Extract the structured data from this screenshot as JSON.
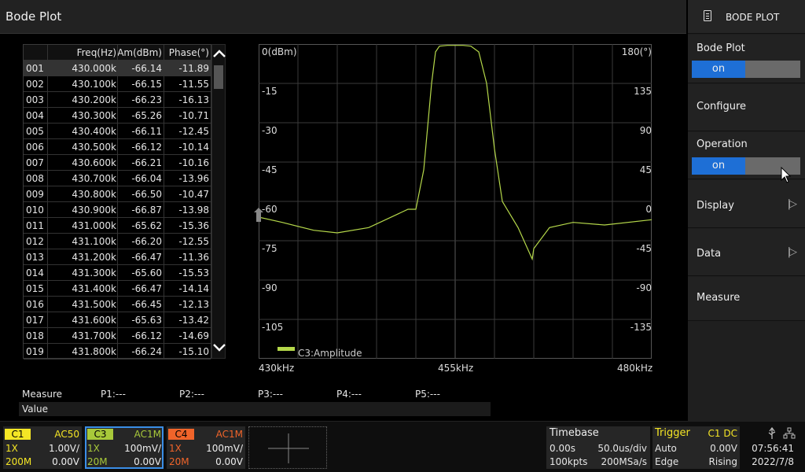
{
  "title": "Bode Plot",
  "menu": {
    "header": "BODE PLOT",
    "items": [
      {
        "label": "Bode Plot",
        "toggle": "on"
      },
      {
        "label": "Configure"
      },
      {
        "label": "Operation",
        "toggle": "on"
      },
      {
        "label": "Display",
        "arrow": "|▷"
      },
      {
        "label": "Data",
        "arrow": "|▷"
      },
      {
        "label": "Measure"
      }
    ]
  },
  "table": {
    "headers": [
      "Freq(Hz)",
      "Am(dBm)",
      "Phase(°)"
    ],
    "rows": [
      [
        "001",
        "430.000k",
        "-66.14",
        "-11.89"
      ],
      [
        "002",
        "430.100k",
        "-66.15",
        "-11.55"
      ],
      [
        "003",
        "430.200k",
        "-66.23",
        "-16.13"
      ],
      [
        "004",
        "430.300k",
        "-65.26",
        "-10.71"
      ],
      [
        "005",
        "430.400k",
        "-66.11",
        "-12.45"
      ],
      [
        "006",
        "430.500k",
        "-66.12",
        "-10.14"
      ],
      [
        "007",
        "430.600k",
        "-66.21",
        "-10.16"
      ],
      [
        "008",
        "430.700k",
        "-66.04",
        "-13.96"
      ],
      [
        "009",
        "430.800k",
        "-66.50",
        "-10.47"
      ],
      [
        "010",
        "430.900k",
        "-66.87",
        "-13.98"
      ],
      [
        "011",
        "431.000k",
        "-65.62",
        "-15.36"
      ],
      [
        "012",
        "431.100k",
        "-66.20",
        "-12.55"
      ],
      [
        "013",
        "431.200k",
        "-66.47",
        "-11.36"
      ],
      [
        "014",
        "431.300k",
        "-65.60",
        "-15.53"
      ],
      [
        "015",
        "431.400k",
        "-66.47",
        "-14.14"
      ],
      [
        "016",
        "431.500k",
        "-66.45",
        "-12.13"
      ],
      [
        "017",
        "431.600k",
        "-65.63",
        "-13.42"
      ],
      [
        "018",
        "431.700k",
        "-66.12",
        "-14.69"
      ],
      [
        "019",
        "431.800k",
        "-66.24",
        "-15.10"
      ]
    ]
  },
  "chart_data": {
    "type": "line",
    "title": "",
    "y_left_ticks": [
      "0(dBm)",
      "-15",
      "-30",
      "-45",
      "-60",
      "-75",
      "-90",
      "-105"
    ],
    "y_right_ticks": [
      "180(°)",
      "135",
      "90",
      "45",
      "0",
      "-45",
      "-90",
      "-135"
    ],
    "x_ticks": [
      "430kHz",
      "455kHz",
      "480kHz"
    ],
    "xlim_khz": [
      430,
      480
    ],
    "ylim_dbm": [
      -120,
      0
    ],
    "legend": "C3:Amplitude",
    "series": [
      {
        "name": "C3:Amplitude",
        "color": "#b5d84a",
        "x": [
          430,
          433,
          437,
          440,
          444,
          449,
          450,
          451,
          452,
          452.5,
          453,
          454,
          456,
          457,
          458,
          459,
          460,
          461,
          463,
          464.8,
          465,
          467,
          470,
          474,
          480
        ],
        "y": [
          -66,
          -68,
          -71,
          -72,
          -70,
          -63,
          -63,
          -48,
          -15,
          -3,
          -0.8,
          -0.5,
          -0.5,
          -0.8,
          -3,
          -15,
          -40,
          -60,
          -70,
          -82,
          -78,
          -70,
          -68,
          -69,
          -67
        ]
      }
    ]
  },
  "measure": {
    "label": "Measure",
    "value_label": "Value",
    "points": [
      "P1:---",
      "P2:---",
      "P3:---",
      "P4:---",
      "P5:---"
    ]
  },
  "channels": [
    {
      "tag": "C1",
      "coupling": "AC50",
      "probe": "1X",
      "scale": "1.00V/",
      "bw": "200M",
      "offset": "0.00V",
      "color": "#f5e625"
    },
    {
      "tag": "C3",
      "coupling": "AC1M",
      "probe": "1X",
      "scale": "100mV/",
      "bw": "20M",
      "offset": "0.00V",
      "color": "#a8c93a"
    },
    {
      "tag": "C4",
      "coupling": "AC1M",
      "probe": "1X",
      "scale": "100mV/",
      "bw": "20M",
      "offset": "0.00V",
      "color": "#f0642a"
    }
  ],
  "timebase": {
    "label": "Timebase",
    "delay": "0.00s",
    "scale": "50.0us/div",
    "points": "100kpts",
    "rate": "200MSa/s"
  },
  "trigger": {
    "label": "Trigger",
    "source": "C1 DC",
    "mode": "Auto",
    "level": "0.00V",
    "type": "Edge",
    "slope": "Rising"
  },
  "clock": {
    "time": "07:56:41",
    "date": "2022/7/8"
  }
}
